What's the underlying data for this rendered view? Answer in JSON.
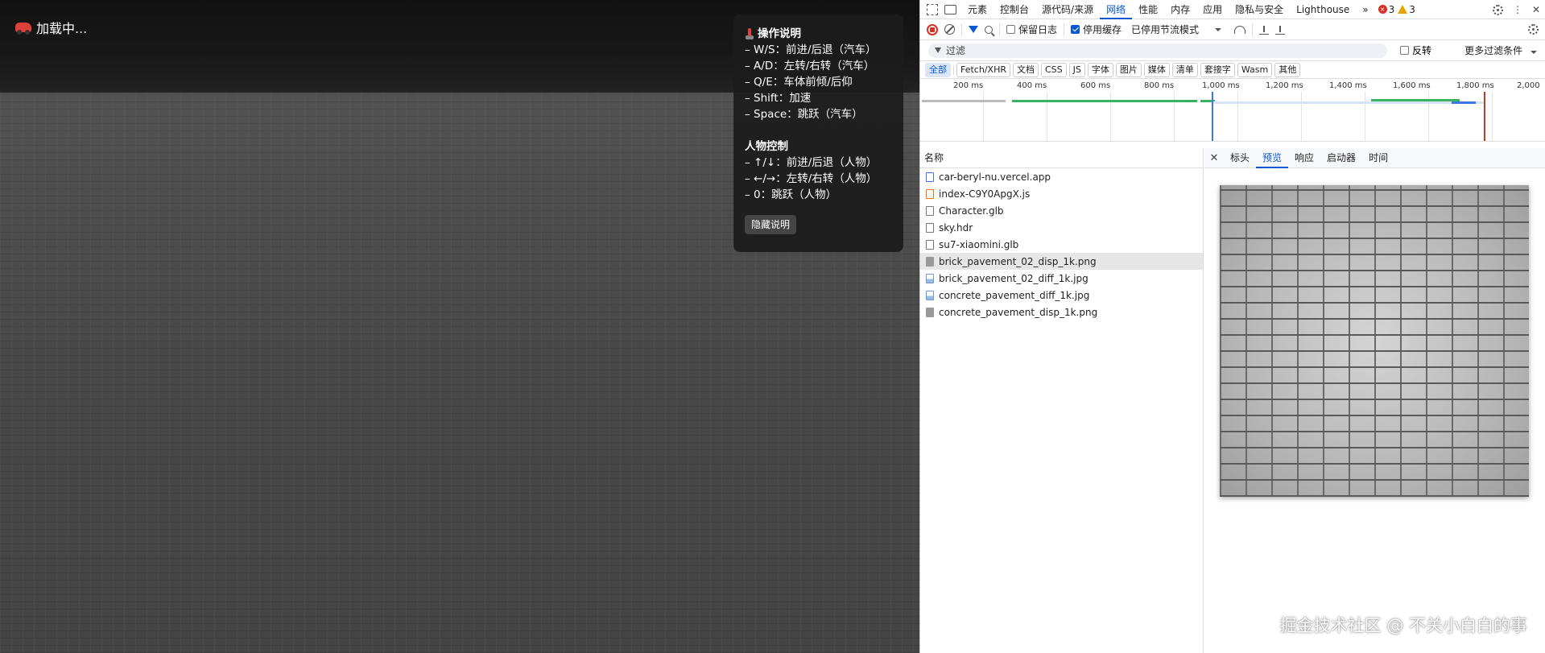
{
  "game": {
    "loading_text": "加载中...",
    "help": {
      "title": "操作说明",
      "car_lines": [
        "– W/S：前进/后退（汽车）",
        "– A/D：左转/右转（汽车）",
        "– Q/E：车体前倾/后仰",
        "– Shift：加速",
        "– Space：跳跃（汽车）"
      ],
      "person_title": "人物控制",
      "person_lines": [
        "– ↑/↓：前进/后退（人物）",
        "– ←/→：左转/右转（人物）",
        "– 0：跳跃（人物）"
      ],
      "hide_button": "隐藏说明"
    }
  },
  "devtools": {
    "tabs": [
      "元素",
      "控制台",
      "源代码/来源",
      "网络",
      "性能",
      "内存",
      "应用",
      "隐私与安全",
      "Lighthouse"
    ],
    "active_tab": "网络",
    "error_count": "3",
    "warning_count": "3",
    "toolbar": {
      "preserve_log": "保留日志",
      "disable_cache": "停用缓存",
      "throttle": "已停用节流模式"
    },
    "filter": {
      "placeholder": "过滤",
      "invert": "反转",
      "more_filters": "更多过滤条件"
    },
    "type_chips": [
      "全部",
      "Fetch/XHR",
      "文档",
      "CSS",
      "JS",
      "字体",
      "图片",
      "媒体",
      "清单",
      "套接字",
      "Wasm",
      "其他"
    ],
    "timeline_ticks": [
      "200 ms",
      "400 ms",
      "600 ms",
      "800 ms",
      "1,000 ms",
      "1,200 ms",
      "1,400 ms",
      "1,600 ms",
      "1,800 ms",
      "2,000"
    ],
    "name_header": "名称",
    "requests": [
      {
        "name": "car-beryl-nu.vercel.app",
        "type": "doc"
      },
      {
        "name": "index-C9Y0ApgX.js",
        "type": "script"
      },
      {
        "name": "Character.glb",
        "type": "file"
      },
      {
        "name": "sky.hdr",
        "type": "file"
      },
      {
        "name": "su7-xiaomini.glb",
        "type": "file"
      },
      {
        "name": "brick_pavement_02_disp_1k.png",
        "type": "img"
      },
      {
        "name": "brick_pavement_02_diff_1k.jpg",
        "type": "jpg"
      },
      {
        "name": "concrete_pavement_diff_1k.jpg",
        "type": "jpg"
      },
      {
        "name": "concrete_pavement_disp_1k.png",
        "type": "img"
      }
    ],
    "selected_request": "brick_pavement_02_disp_1k.png",
    "detail_tabs": [
      "标头",
      "预览",
      "响应",
      "启动器",
      "时间"
    ],
    "active_detail_tab": "预览"
  },
  "watermark": "掘金技术社区 @ 不关小白白的事",
  "colors": {
    "accent": "#0b57d0",
    "error": "#d93025",
    "warning": "#e8a300"
  }
}
